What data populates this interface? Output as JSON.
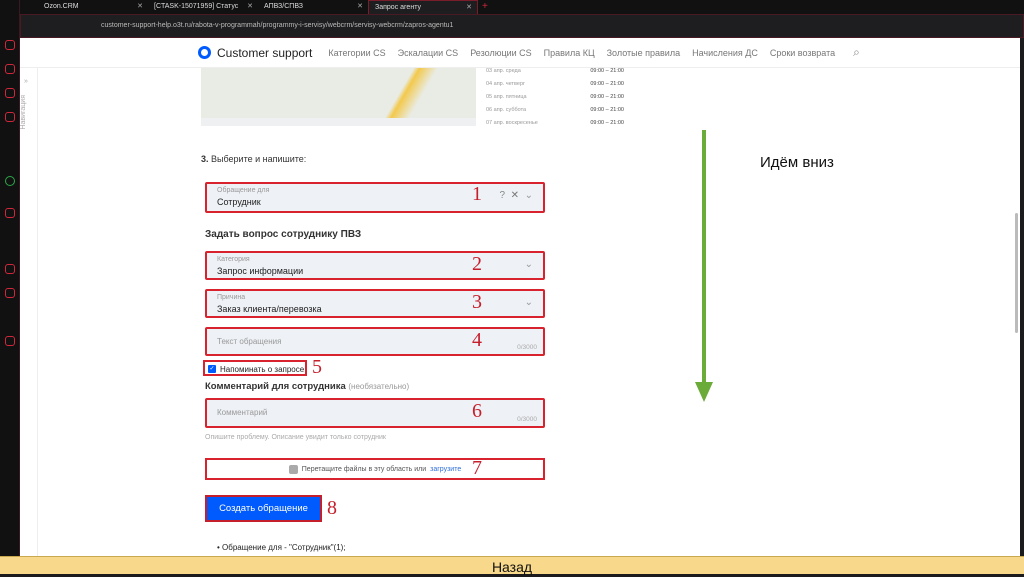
{
  "browser": {
    "tabs": [
      {
        "label": "Ozon.CRM"
      },
      {
        "label": "[CTASK-15071959] Статус"
      },
      {
        "label": "АПВЗ/СПВЗ"
      },
      {
        "label": "Запрос агенту",
        "active": true
      }
    ],
    "url": "customer-support-help.o3t.ru/rabota-v-programmah/programmy-i-servisy/webcrm/servisy-webcrm/zapros-agentu1"
  },
  "header": {
    "brand": "Customer support",
    "nav": [
      "Категории CS",
      "Эскалации CS",
      "Резолюции CS",
      "Правила КЦ",
      "Золотые правила",
      "Начисления ДС",
      "Сроки возврата"
    ]
  },
  "sidebar": {
    "label": "Навигация"
  },
  "schedule": [
    {
      "day": "03 апр. среда",
      "hours": "09:00 – 21:00"
    },
    {
      "day": "04 апр. четверг",
      "hours": "09:00 – 21:00"
    },
    {
      "day": "05 апр. пятница",
      "hours": "09:00 – 21:00"
    },
    {
      "day": "06 апр. суббота",
      "hours": "09:00 – 21:00"
    },
    {
      "day": "07 апр. воскресенье",
      "hours": "09:00 – 21:00"
    }
  ],
  "form": {
    "step_num": "3.",
    "step_text": " Выберите и напишите:",
    "appeal_label": "Обращение для",
    "appeal_value": "Сотрудник",
    "section_title": "Задать вопрос сотруднику ПВЗ",
    "category_label": "Категория",
    "category_value": "Запрос информации",
    "reason_label": "Причина",
    "reason_value": "Заказ клиента/перевозка",
    "text_placeholder": "Текст обращения",
    "text_count": "0/3000",
    "remind_label": "Напоминать о запросе",
    "comment_title": "Комментарий для сотрудника",
    "comment_optional": "(необязательно)",
    "comment_placeholder": "Комментарий",
    "comment_count": "0/3000",
    "comment_hint": "Опишите проблему. Описание увидит только сотрудник",
    "drop_text": "Перетащите файлы в эту область или",
    "drop_link": "загрузите",
    "submit": "Создать обращение",
    "bullet": "Обращение для - \"Сотрудник\"(1);"
  },
  "annotations": {
    "n1": "1",
    "n2": "2",
    "n3": "3",
    "n4": "4",
    "n5": "5",
    "n6": "6",
    "n7": "7",
    "n8": "8",
    "note": "Идём вниз"
  },
  "footer": {
    "back": "Назад"
  },
  "colors": {
    "accent": "#005bff",
    "highlight": "#d8232f",
    "arrow": "#6aab3a"
  }
}
